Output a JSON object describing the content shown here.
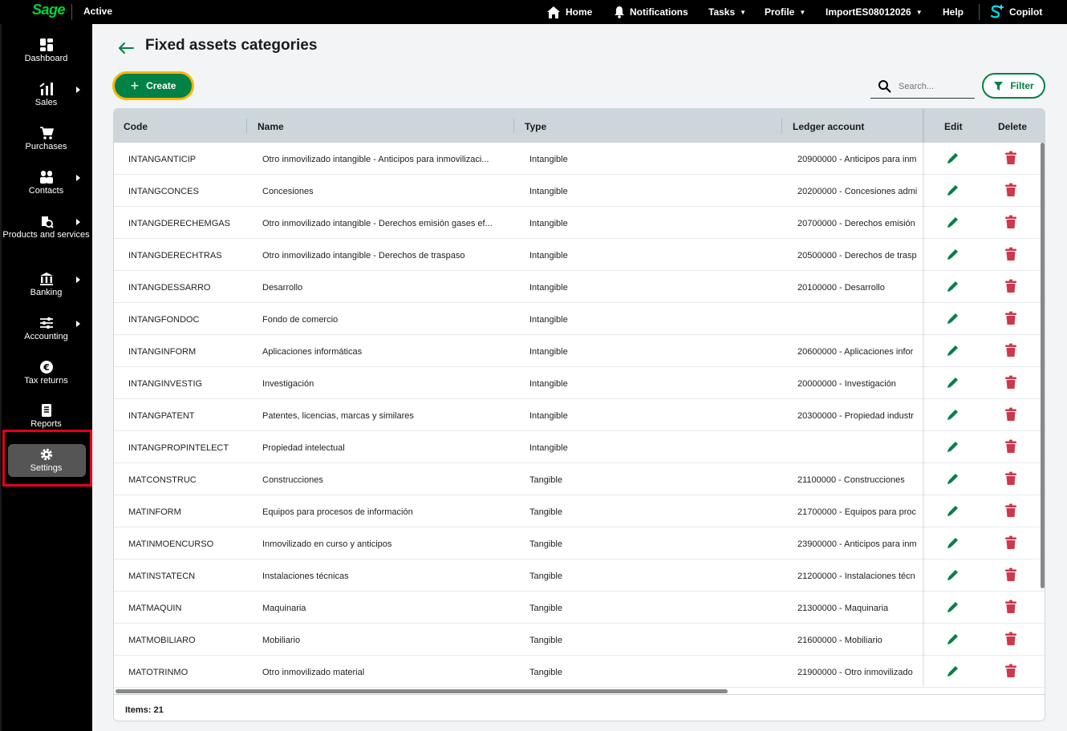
{
  "topbar": {
    "logo": "Sage",
    "company_status": "Active",
    "home": "Home",
    "notifications": "Notifications",
    "tasks": "Tasks",
    "profile": "Profile",
    "company": "ImportES08012026",
    "help": "Help",
    "copilot": "Copilot"
  },
  "sidebar": {
    "items": [
      {
        "label": "Dashboard",
        "icon": "dashboard-icon"
      },
      {
        "label": "Sales",
        "icon": "sales-chart-icon"
      },
      {
        "label": "Purchases",
        "icon": "cart-icon"
      },
      {
        "label": "Contacts",
        "icon": "contacts-icon"
      },
      {
        "label": "Products and services",
        "icon": "products-icon"
      },
      {
        "label": "Banking",
        "icon": "bank-icon"
      },
      {
        "label": "Accounting",
        "icon": "sliders-icon"
      },
      {
        "label": "Tax returns",
        "icon": "euro-icon"
      },
      {
        "label": "Reports",
        "icon": "report-icon"
      },
      {
        "label": "Settings",
        "icon": "gear-icon"
      }
    ]
  },
  "page": {
    "title": "Fixed assets categories",
    "create_label": "Create",
    "search_placeholder": "Search...",
    "filter_label": "Filter"
  },
  "table": {
    "headers": {
      "code": "Code",
      "name": "Name",
      "type": "Type",
      "ledger": "Ledger account",
      "edit": "Edit",
      "delete": "Delete"
    },
    "rows": [
      {
        "code": "INTANGANTICIP",
        "name": "Otro inmovilizado intangible - Anticipos para inmovilizaci...",
        "type": "Intangible",
        "ledger": "20900000 - Anticipos para inm"
      },
      {
        "code": "INTANGCONCES",
        "name": "Concesiones",
        "type": "Intangible",
        "ledger": "20200000 - Concesiones admi"
      },
      {
        "code": "INTANGDERECHEMGAS",
        "name": "Otro inmovilizado intangible - Derechos emisión gases ef...",
        "type": "Intangible",
        "ledger": "20700000 - Derechos emisión"
      },
      {
        "code": "INTANGDERECHTRAS",
        "name": "Otro inmovilizado intangible - Derechos de traspaso",
        "type": "Intangible",
        "ledger": "20500000 - Derechos de trasp"
      },
      {
        "code": "INTANGDESSARRO",
        "name": "Desarrollo",
        "type": "Intangible",
        "ledger": "20100000 - Desarrollo"
      },
      {
        "code": "INTANGFONDOC",
        "name": "Fondo de comercio",
        "type": "Intangible",
        "ledger": ""
      },
      {
        "code": "INTANGINFORM",
        "name": "Aplicaciones informáticas",
        "type": "Intangible",
        "ledger": "20600000 - Aplicaciones infor"
      },
      {
        "code": "INTANGINVESTIG",
        "name": "Investigación",
        "type": "Intangible",
        "ledger": "20000000 - Investigación"
      },
      {
        "code": "INTANGPATENT",
        "name": "Patentes, licencias, marcas y similares",
        "type": "Intangible",
        "ledger": "20300000 - Propiedad industr"
      },
      {
        "code": "INTANGPROPINTELECT",
        "name": "Propiedad intelectual",
        "type": "Intangible",
        "ledger": ""
      },
      {
        "code": "MATCONSTRUC",
        "name": "Construcciones",
        "type": "Tangible",
        "ledger": "21100000 - Construcciones"
      },
      {
        "code": "MATINFORM",
        "name": "Equipos para procesos de información",
        "type": "Tangible",
        "ledger": "21700000 - Equipos para proc"
      },
      {
        "code": "MATINMOENCURSO",
        "name": "Inmovilizado en curso y anticipos",
        "type": "Tangible",
        "ledger": "23900000 - Anticipos para inm"
      },
      {
        "code": "MATINSTATECN",
        "name": "Instalaciones técnicas",
        "type": "Tangible",
        "ledger": "21200000 - Instalaciones técn"
      },
      {
        "code": "MATMAQUIN",
        "name": "Maquinaria",
        "type": "Tangible",
        "ledger": "21300000 - Maquinaria"
      },
      {
        "code": "MATMOBILIARO",
        "name": "Mobiliario",
        "type": "Tangible",
        "ledger": "21600000 - Mobiliario"
      },
      {
        "code": "MATOTRINMO",
        "name": "Otro inmovilizado material",
        "type": "Tangible",
        "ledger": "21900000 - Otro inmovilizado"
      }
    ],
    "footer": "Items: 21"
  },
  "colors": {
    "brand_green": "#008146",
    "logo_green": "#00d639",
    "focus_yellow": "#ffb500",
    "delete_red": "#cd384b",
    "highlight_red": "#e3001b"
  }
}
